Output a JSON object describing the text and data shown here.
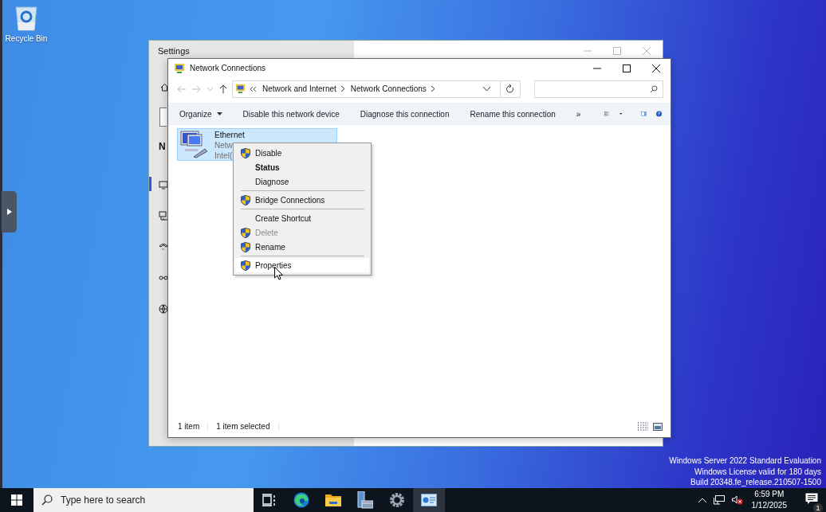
{
  "desktop": {
    "icons": [
      {
        "label": "Recycle Bin"
      }
    ],
    "edition_lines": [
      "Windows Server 2022 Standard Evaluation",
      "Windows License valid for 180 days",
      "Build 20348.fe_release.210507-1500"
    ]
  },
  "settings_window": {
    "title": "Settings",
    "heading": "N",
    "nav_items": [
      {
        "kind": "status",
        "selected": true
      },
      {
        "kind": "ethernet",
        "selected": false
      },
      {
        "kind": "dialup",
        "selected": false
      },
      {
        "kind": "vpn",
        "selected": false
      },
      {
        "kind": "proxy",
        "selected": false
      }
    ]
  },
  "explorer": {
    "title": "Network Connections",
    "breadcrumb": [
      "Network and Internet",
      "Network Connections"
    ],
    "toolbar": [
      {
        "label": "Organize",
        "kind": "menu"
      },
      {
        "label": "Disable this network device",
        "kind": "button"
      },
      {
        "label": "Diagnose this connection",
        "kind": "button"
      },
      {
        "label": "Rename this connection",
        "kind": "button"
      },
      {
        "label": "»",
        "kind": "overflow"
      }
    ],
    "items": [
      {
        "name": "Ethernet",
        "lines": [
          "Netw",
          "Intel("
        ],
        "selected": true
      }
    ],
    "status": [
      "1 item",
      "1 item selected"
    ]
  },
  "context_menu": {
    "items": [
      {
        "kind": "item",
        "label": "Disable",
        "shield": true,
        "default": false,
        "disabled": false,
        "selected": false
      },
      {
        "kind": "item",
        "label": "Status",
        "shield": false,
        "default": true,
        "disabled": false,
        "selected": false
      },
      {
        "kind": "item",
        "label": "Diagnose",
        "shield": false,
        "default": false,
        "disabled": false,
        "selected": false
      },
      {
        "kind": "separator"
      },
      {
        "kind": "item",
        "label": "Bridge Connections",
        "shield": true,
        "default": false,
        "disabled": false,
        "selected": false
      },
      {
        "kind": "separator"
      },
      {
        "kind": "item",
        "label": "Create Shortcut",
        "shield": false,
        "default": false,
        "disabled": false,
        "selected": false
      },
      {
        "kind": "item",
        "label": "Delete",
        "shield": true,
        "default": false,
        "disabled": true,
        "selected": false
      },
      {
        "kind": "item",
        "label": "Rename",
        "shield": true,
        "default": false,
        "disabled": false,
        "selected": false
      },
      {
        "kind": "separator"
      },
      {
        "kind": "item",
        "label": "Properties",
        "shield": true,
        "default": false,
        "disabled": false,
        "selected": true
      }
    ]
  },
  "taskbar": {
    "search_placeholder": "Type here to search",
    "apps": [
      {
        "kind": "task-view",
        "selected": false
      },
      {
        "kind": "browser",
        "selected": false
      },
      {
        "kind": "folder",
        "selected": false
      },
      {
        "kind": "server",
        "selected": false
      },
      {
        "kind": "gear",
        "selected": false
      },
      {
        "kind": "window",
        "selected": true
      }
    ],
    "time": "6:59 PM",
    "date": "1/12/2025",
    "notification_count": "1"
  }
}
